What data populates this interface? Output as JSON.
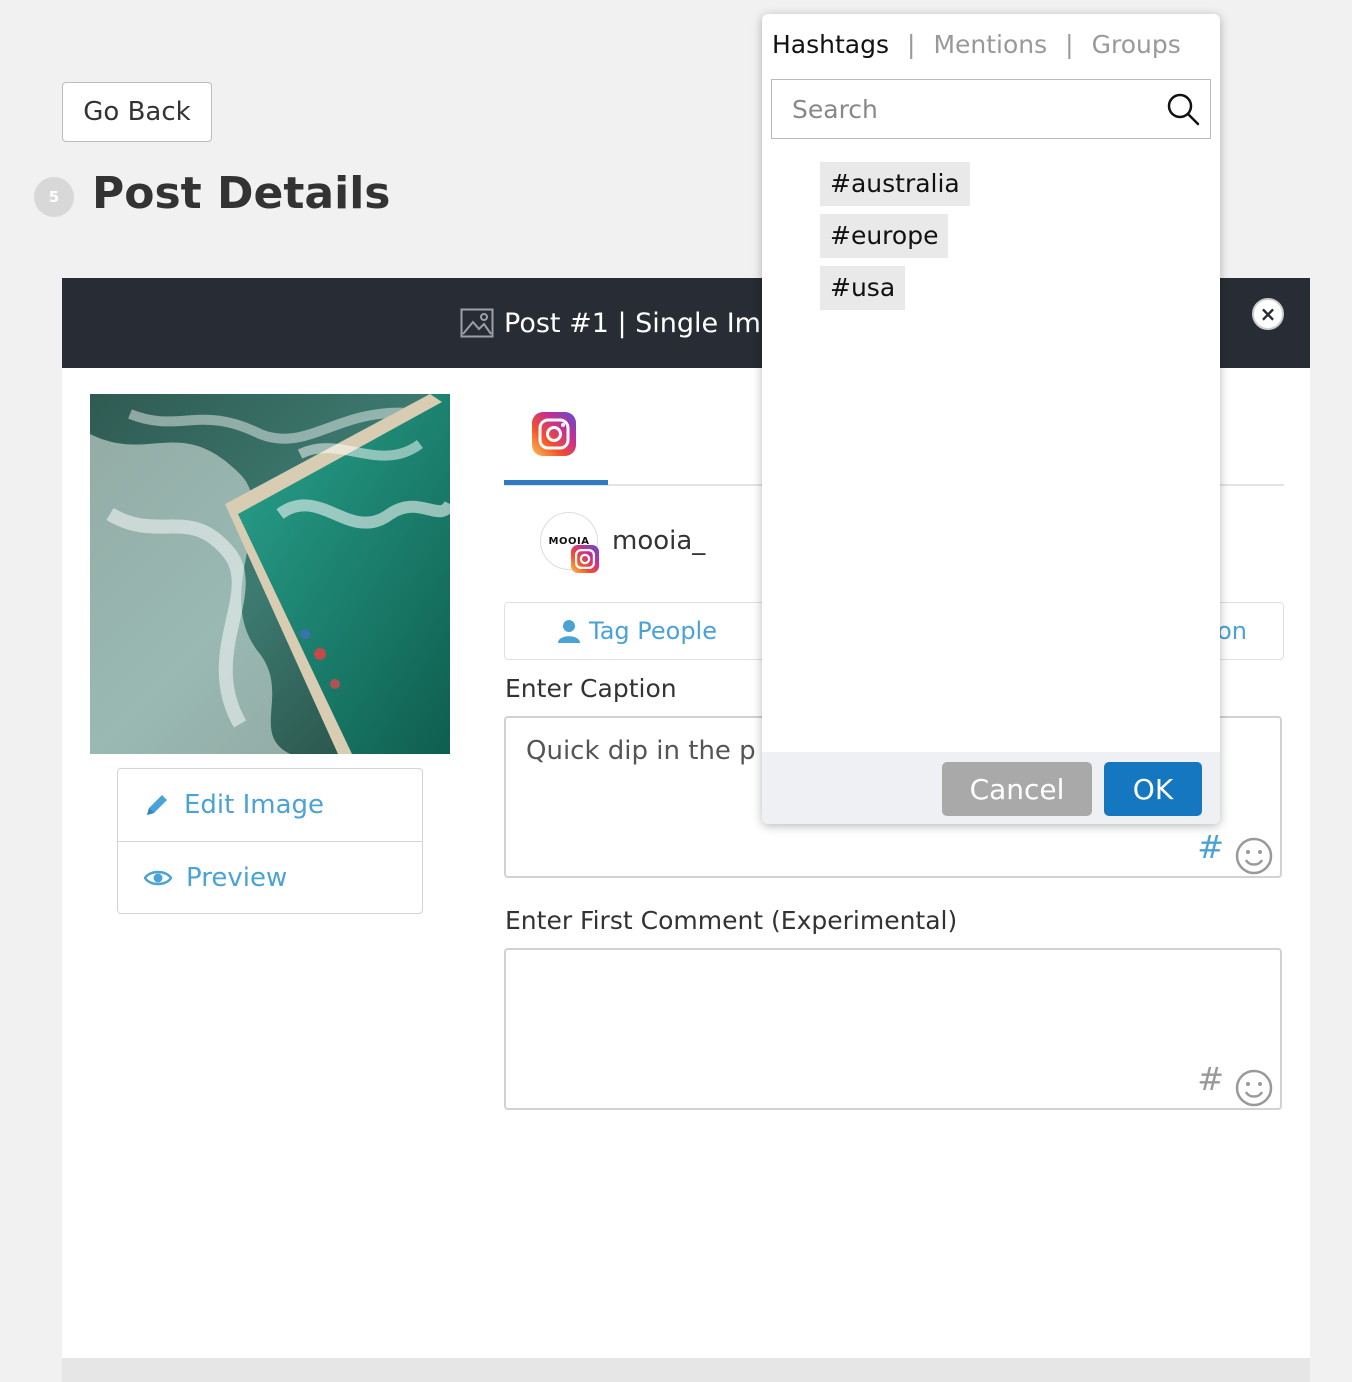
{
  "nav": {
    "go_back_label": "Go Back"
  },
  "page": {
    "step_number": "5",
    "title": "Post Details"
  },
  "post": {
    "header_title": "Post #1 | Single Ima",
    "close_symbol": "×",
    "image_actions": {
      "edit_label": "Edit Image",
      "preview_label": "Preview"
    },
    "account": {
      "avatar_text": "MOOIA",
      "name": "mooia_"
    },
    "tag_people_label": "Tag People",
    "location_label_visible": "on",
    "caption": {
      "label": "Enter Caption",
      "value": "Quick dip in the p"
    },
    "first_comment": {
      "label": "Enter First Comment (Experimental)",
      "value": ""
    },
    "hash_symbol": "#"
  },
  "popup": {
    "tabs": [
      {
        "label": "Hashtags",
        "active": true
      },
      {
        "label": "Mentions",
        "active": false
      },
      {
        "label": "Groups",
        "active": false
      }
    ],
    "separator": "|",
    "search_placeholder": "Search",
    "hashtags": [
      "#australia",
      "#europe",
      "#usa"
    ],
    "cancel_label": "Cancel",
    "ok_label": "OK"
  },
  "icons": {
    "header": "image-icon",
    "close": "close-icon",
    "edit": "pencil-icon",
    "preview": "eye-icon",
    "tag": "person-icon",
    "search": "search-icon",
    "emoji": "smiley-icon",
    "network": "instagram-icon"
  },
  "colors": {
    "accent_blue": "#1577c0",
    "link_blue": "#4aa3d4",
    "header_dark": "#282c34",
    "tab_underline": "#2e7bc4",
    "hash_active": "#4aa3d4",
    "hash_inactive": "#999999",
    "cancel_gray": "#a9a9a9"
  }
}
